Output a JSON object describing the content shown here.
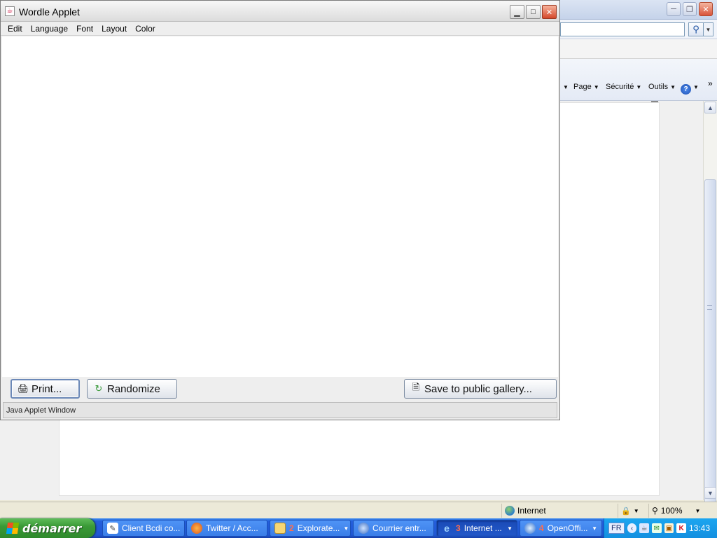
{
  "applet": {
    "title": "Wordle Applet",
    "menu": [
      "Edit",
      "Language",
      "Font",
      "Layout",
      "Color"
    ],
    "buttons": {
      "print": "Print...",
      "randomize": "Randomize",
      "save_gallery": "Save to public gallery..."
    },
    "status": "Java Applet Window"
  },
  "ie": {
    "commands": [
      "Page",
      "Sécurité",
      "Outils"
    ],
    "status_zone": "Internet",
    "zoom": "100%"
  },
  "taskbar": {
    "start_label": "démarrer",
    "tasks": [
      {
        "label": "Client Bcdi co...",
        "num": ""
      },
      {
        "label": "Twitter / Acc...",
        "num": ""
      },
      {
        "label": "Explorate...",
        "num": "2"
      },
      {
        "label": "Courrier entr...",
        "num": ""
      },
      {
        "label": "Internet ...",
        "num": "3"
      },
      {
        "label": "OpenOffi...",
        "num": "4"
      }
    ],
    "tray": {
      "lang": "FR",
      "clock": "13:43"
    }
  },
  "colors": {
    "xp_blue": "#245edb",
    "start_green": "#3b9a37",
    "close_red": "#d4482a"
  }
}
